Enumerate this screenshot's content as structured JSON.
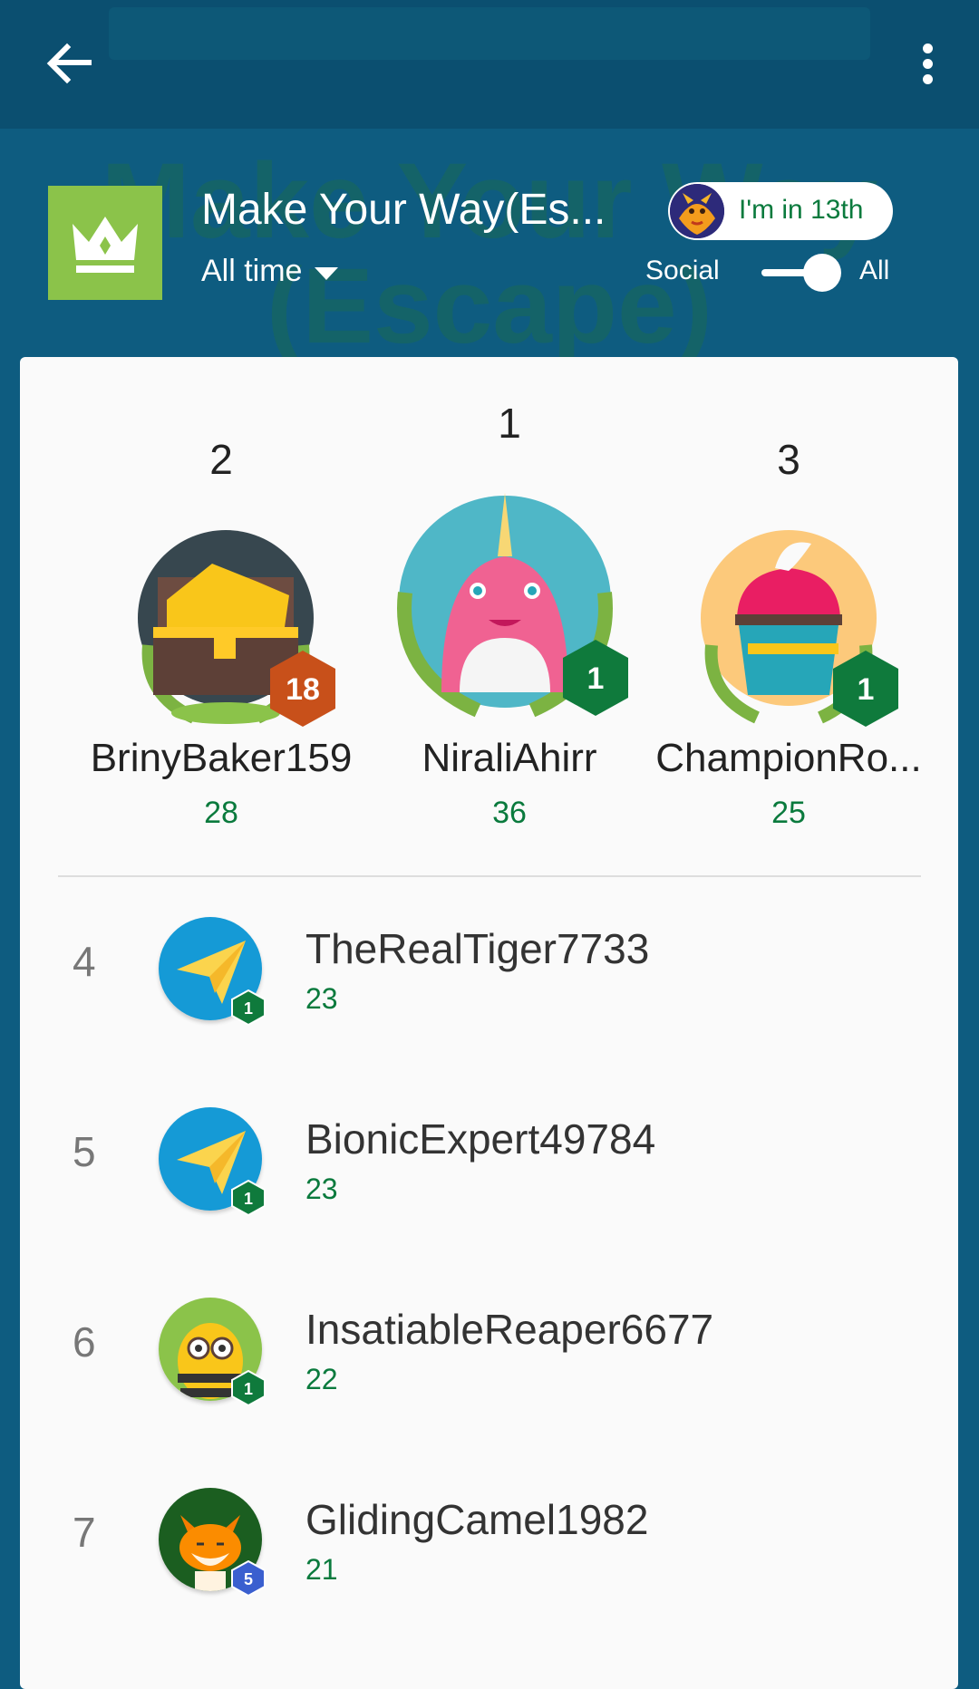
{
  "app_bar": {
    "back_icon": "arrow-back-icon",
    "menu_icon": "more-vert-icon"
  },
  "header": {
    "watermark_line1": "Make Your Way",
    "watermark_line2": "(Escape)",
    "title": "Make Your Way(Es...",
    "timeframe": "All time",
    "rank_chip_label": "I'm in 13th",
    "social_label": "Social",
    "all_label": "All",
    "crown_icon": "crown-icon"
  },
  "podium": [
    {
      "rank": "2",
      "name": "BrinyBaker159",
      "score": "28",
      "level": "18",
      "level_color": "#c8501a",
      "avatar": "treasure-chest-avatar"
    },
    {
      "rank": "1",
      "name": "NiraliAhirr",
      "score": "36",
      "level": "1",
      "level_color": "#0f7a3c",
      "avatar": "narwhal-avatar"
    },
    {
      "rank": "3",
      "name": "ChampionRo...",
      "score": "25",
      "level": "1",
      "level_color": "#0f7a3c",
      "avatar": "cupcake-avatar"
    }
  ],
  "list": [
    {
      "rank": "4",
      "name": "TheRealTiger7733",
      "score": "23",
      "level": "1",
      "level_color": "#0f7a3c",
      "avatar": "paper-plane-avatar"
    },
    {
      "rank": "5",
      "name": "BionicExpert49784",
      "score": "23",
      "level": "1",
      "level_color": "#0f7a3c",
      "avatar": "paper-plane-avatar"
    },
    {
      "rank": "6",
      "name": "InsatiableReaper6677",
      "score": "22",
      "level": "1",
      "level_color": "#0f7a3c",
      "avatar": "bee-avatar"
    },
    {
      "rank": "7",
      "name": "GlidingCamel1982",
      "score": "21",
      "level": "5",
      "level_color": "#3a5fcf",
      "avatar": "fox-avatar"
    }
  ]
}
